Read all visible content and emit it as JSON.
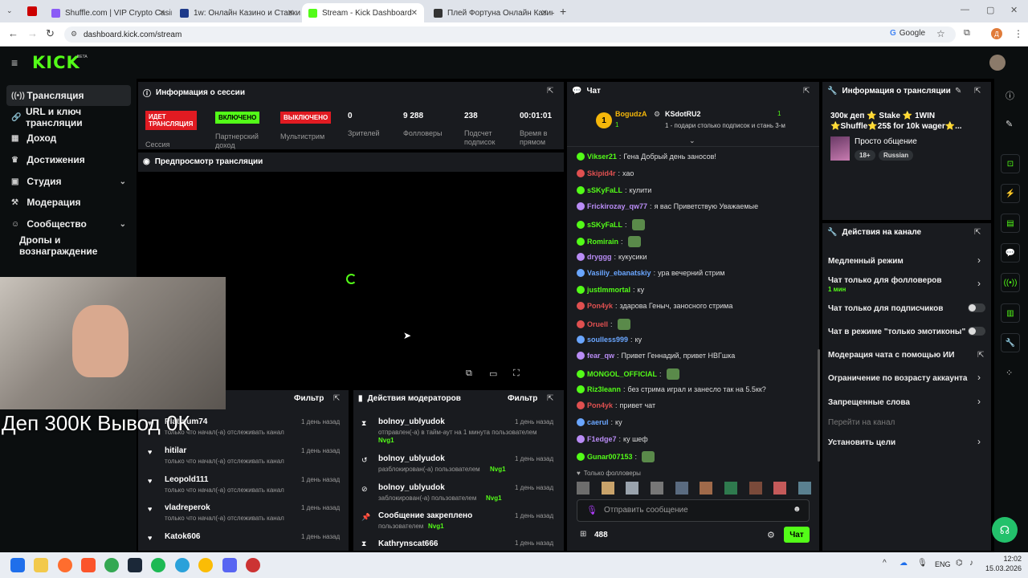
{
  "browser": {
    "tabs": [
      {
        "title": "Shuffle.com | VIP Crypto Casino",
        "color": "#8b5cf6"
      },
      {
        "title": "1w: Онлайн Казино и Ставки",
        "color": "#1e3a8a"
      },
      {
        "title": "Stream - Kick Dashboard",
        "color": "#53fc18"
      },
      {
        "title": "Плей Фортуна Онлайн Казино",
        "color": "#333333"
      }
    ],
    "url": "dashboard.kick.com/stream",
    "google_label": "Google",
    "profile_letter": "Д"
  },
  "kick": {
    "logo": "KICK",
    "beta": "BETA"
  },
  "sidebar": {
    "items": [
      {
        "label": "Трансляция",
        "icon": "broadcast-icon"
      },
      {
        "label": "URL и ключ трансляции",
        "icon": "link-icon"
      },
      {
        "label": "Доход",
        "icon": "money-icon"
      },
      {
        "label": "Достижения",
        "icon": "trophy-icon"
      },
      {
        "label": "Студия",
        "icon": "studio-icon"
      },
      {
        "label": "Модерация",
        "icon": "hammer-icon"
      },
      {
        "label": "Сообщество",
        "icon": "community-icon"
      },
      {
        "label": "Дропы и вознаграждение",
        "icon": ""
      }
    ]
  },
  "session": {
    "title": "Информация о сессии",
    "live_badge": "ИДЕТ ТРАНСЛЯЦИЯ",
    "live_label": "Сессия",
    "partner_badge": "ВКЛЮЧЕНО",
    "partner_label": "Партнерский доход",
    "multi_badge": "ВЫКЛЮЧЕНО",
    "multi_label": "Мультистрим",
    "stats": [
      {
        "value": "0",
        "label": "Зрителей"
      },
      {
        "value": "9 288",
        "label": "Фолловеры"
      },
      {
        "value": "238",
        "label": "Подсчет подписок"
      },
      {
        "value": "00:01:01",
        "label": "Время в прямом"
      }
    ]
  },
  "preview": {
    "title": "Предпросмотр трансляции"
  },
  "overlay_text": "Деп 300К Вывод 0К",
  "activity": {
    "filter_label": "Фильтр",
    "items": [
      {
        "user": "Platinum74",
        "desc": "только что начал(-а) отслеживать канал",
        "time": "1 день назад"
      },
      {
        "user": "hitilar",
        "desc": "только что начал(-а) отслеживать канал",
        "time": "1 день назад"
      },
      {
        "user": "Leopold111",
        "desc": "только что начал(-а) отслеживать канал",
        "time": "1 день назад"
      },
      {
        "user": "vladreperok",
        "desc": "только что начал(-а) отслеживать канал",
        "time": "1 день назад"
      },
      {
        "user": "Katok606",
        "desc": "только что начал(-а) отслеживать канал",
        "time": "1 день назад"
      }
    ]
  },
  "modactions": {
    "title": "Действия модераторов",
    "filter_label": "Фильтр",
    "items": [
      {
        "user": "bolnoy_ublyudok",
        "desc": "отправлен(-а) в тайм-аут на 1 минута пользователем",
        "target": "Nvg1",
        "time": "1 день назад",
        "icon": "hourglass-icon"
      },
      {
        "user": "bolnoy_ublyudok",
        "desc": "разблокирован(-а) пользователем",
        "target": "Nvg1",
        "time": "1 день назад",
        "icon": "unban-icon"
      },
      {
        "user": "bolnoy_ublyudok",
        "desc": "заблокирован(-а) пользователем",
        "target": "Nvg1",
        "time": "1 день назад",
        "icon": "ban-icon"
      },
      {
        "user": "Сообщение закреплено",
        "desc": "пользователем",
        "target": "Nvg1",
        "time": "1 день назад",
        "icon": "pin-icon"
      },
      {
        "user": "Kathrynscat666",
        "desc": "",
        "target": "",
        "time": "1 день назад",
        "icon": "hourglass-icon"
      }
    ]
  },
  "chat": {
    "title": "Чат",
    "pinned_user": "BogudzA",
    "pinned_count": "1",
    "pinned2_user": "KSdotRU2",
    "pinned2_count": "1",
    "pinned2_desc": "1 - подари столько подписок и стань 3-м",
    "messages": [
      {
        "user": "Vikser21",
        "text": "Гена Добрый день заносов!",
        "color": "#53fc18"
      },
      {
        "user": "Skipid4r",
        "text": "хао",
        "color": "#e05050"
      },
      {
        "user": "sSKyFaLL",
        "text": "кулити",
        "color": "#53fc18"
      },
      {
        "user": "Frickirozay_qw77",
        "text": "я вас Приветствую Уважаемые",
        "color": "#b98cf5"
      },
      {
        "user": "sSKyFaLL",
        "text": "",
        "color": "#53fc18"
      },
      {
        "user": "Romirain",
        "text": "",
        "color": "#53fc18"
      },
      {
        "user": "dryggg",
        "text": "кукусики",
        "color": "#b98cf5"
      },
      {
        "user": "Vasiliy_ebanatskiy",
        "text": "ура вечерний стрим",
        "color": "#6aa6ff"
      },
      {
        "user": "justImmortal",
        "text": "ку",
        "color": "#53fc18"
      },
      {
        "user": "Pon4yk",
        "text": "здарова Геныч, заносного стрима",
        "color": "#e05050"
      },
      {
        "user": "Oruell",
        "text": "",
        "color": "#e05050"
      },
      {
        "user": "soulless999",
        "text": "ку",
        "color": "#6aa6ff"
      },
      {
        "user": "fear_qw",
        "text": "Привет Геннадий, привет НВГшка",
        "color": "#b98cf5"
      },
      {
        "user": "MONGOL_OFFICIAL",
        "text": "",
        "color": "#53fc18"
      },
      {
        "user": "Riz3leann",
        "text": "без стрима играл и занесло так на 5.5кк?",
        "color": "#53fc18"
      },
      {
        "user": "Pon4yk",
        "text": "привет чат",
        "color": "#e05050"
      },
      {
        "user": "caerul",
        "text": "ку",
        "color": "#6aa6ff"
      },
      {
        "user": "F1edge7",
        "text": "ку шеф",
        "color": "#b98cf5"
      },
      {
        "user": "Gunar007153",
        "text": "",
        "color": "#53fc18"
      }
    ],
    "followers_only": "Только фолловеры",
    "input_placeholder": "Отправить сообщение",
    "points": "488",
    "send_label": "Чат"
  },
  "stream_info": {
    "title": "Информация о трансляции",
    "stream_title": "300к деп ⭐ Stake ⭐ 1WIN ⭐Shuffle⭐25$ for 10k wager⭐...",
    "category": "Просто общение",
    "tags": [
      "18+",
      "Russian"
    ]
  },
  "channel_actions": {
    "title": "Действия на канале",
    "rows": [
      {
        "label": "Медленный режим",
        "sub": ""
      },
      {
        "label": "Чат только для фолловеров",
        "sub": "1 мин"
      },
      {
        "label": "Чат только для подписчиков",
        "sub": ""
      },
      {
        "label": "Чат в режиме \"только эмотиконы\"",
        "sub": ""
      },
      {
        "label": "Модерация чата с помощью ИИ",
        "sub": ""
      },
      {
        "label": "Ограничение по возрасту аккаунта",
        "sub": ""
      },
      {
        "label": "Запрещенные слова",
        "sub": ""
      },
      {
        "label": "Перейти на канал",
        "sub": ""
      },
      {
        "label": "Установить цели",
        "sub": ""
      }
    ]
  },
  "taskbar": {
    "lang": "ENG",
    "time": "12:02",
    "date": "15.03.2026"
  }
}
